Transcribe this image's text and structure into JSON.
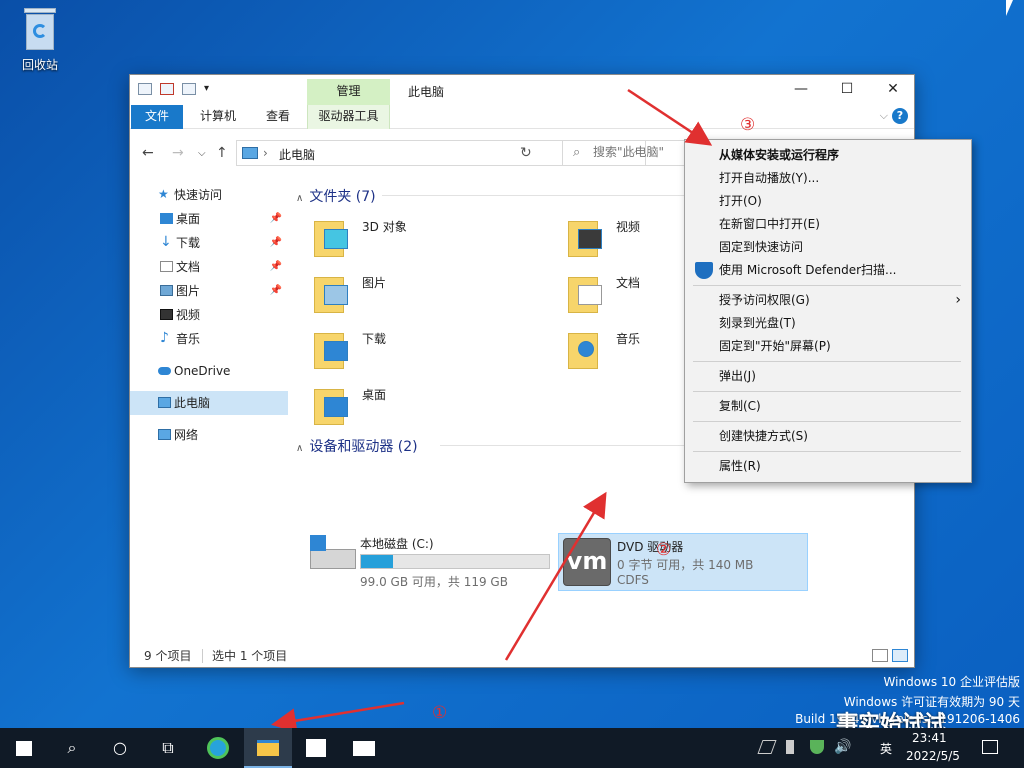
{
  "desktop": {
    "recycle_bin_label": "回收站"
  },
  "window": {
    "title": "此电脑",
    "manage_tab": "管理",
    "controls": {
      "minimize": "—",
      "maximize": "☐",
      "close": "✕"
    }
  },
  "ribbon": {
    "tabs": {
      "file": "文件",
      "computer": "计算机",
      "view": "查看",
      "drive_tools": "驱动器工具"
    },
    "collapse": "⌵",
    "help": "?"
  },
  "navigation": {
    "back": "←",
    "forward": "→",
    "history": "⌵",
    "up": "↑",
    "separator": "›",
    "address": "此电脑",
    "address_dropdown": "⌵",
    "refresh": "↻",
    "search_placeholder": "搜索\"此电脑\""
  },
  "sidebar": {
    "quick_access": "快速访问",
    "items": [
      {
        "label": "桌面",
        "icon": "desktop-icon",
        "pin": "📌"
      },
      {
        "label": "下载",
        "icon": "download-icon",
        "pin": "📌"
      },
      {
        "label": "文档",
        "icon": "document-icon",
        "pin": "📌"
      },
      {
        "label": "图片",
        "icon": "pictures-icon",
        "pin": "📌"
      },
      {
        "label": "视频",
        "icon": "video-icon"
      },
      {
        "label": "音乐",
        "icon": "music-icon"
      }
    ],
    "onedrive": "OneDrive",
    "this_pc": "此电脑",
    "network": "网络"
  },
  "content": {
    "folders_header": "文件夹 (7)",
    "folders": [
      "3D 对象",
      "视频",
      "图片",
      "文档",
      "下载",
      "音乐",
      "桌面"
    ],
    "devices_header": "设备和驱动器 (2)",
    "local_disk": {
      "name": "本地磁盘 (C:)",
      "usage_fraction": 0.17,
      "free_text": "99.0 GB 可用，共 119 GB"
    },
    "dvd": {
      "name": "DVD 驱动器",
      "space_text": "0 字节 可用，共 140 MB",
      "fs": "CDFS",
      "logo": "vm"
    }
  },
  "status": {
    "count": "9 个项目",
    "selected": "选中 1 个项目"
  },
  "context_menu": {
    "items": [
      "从媒体安装或运行程序",
      "打开自动播放(Y)...",
      "打开(O)",
      "在新窗口中打开(E)",
      "固定到快速访问",
      "使用 Microsoft Defender扫描...",
      "授予访问权限(G)",
      "刻录到光盘(T)",
      "固定到\"开始\"屏幕(P)",
      "弹出(J)",
      "复制(C)",
      "创建快捷方式(S)",
      "属性(R)"
    ],
    "submenu_arrow": "›"
  },
  "annotations": {
    "one": "①",
    "two": "②",
    "three": "③"
  },
  "colors": {
    "arrow": "#e03030",
    "accent": "#1979ca"
  },
  "watermark": {
    "line1": "Windows 10 企业评估版",
    "line2": "Windows 许可证有效期为 90 天",
    "line3": "Build 19041.vb_release.191206-1406",
    "wechat": "事实始试试"
  },
  "taskbar": {
    "search": "⌕",
    "cortana": "○",
    "task_view": "⧉",
    "language": "英",
    "volume": "🔊",
    "time": "23:41",
    "date": "2022/5/5"
  }
}
